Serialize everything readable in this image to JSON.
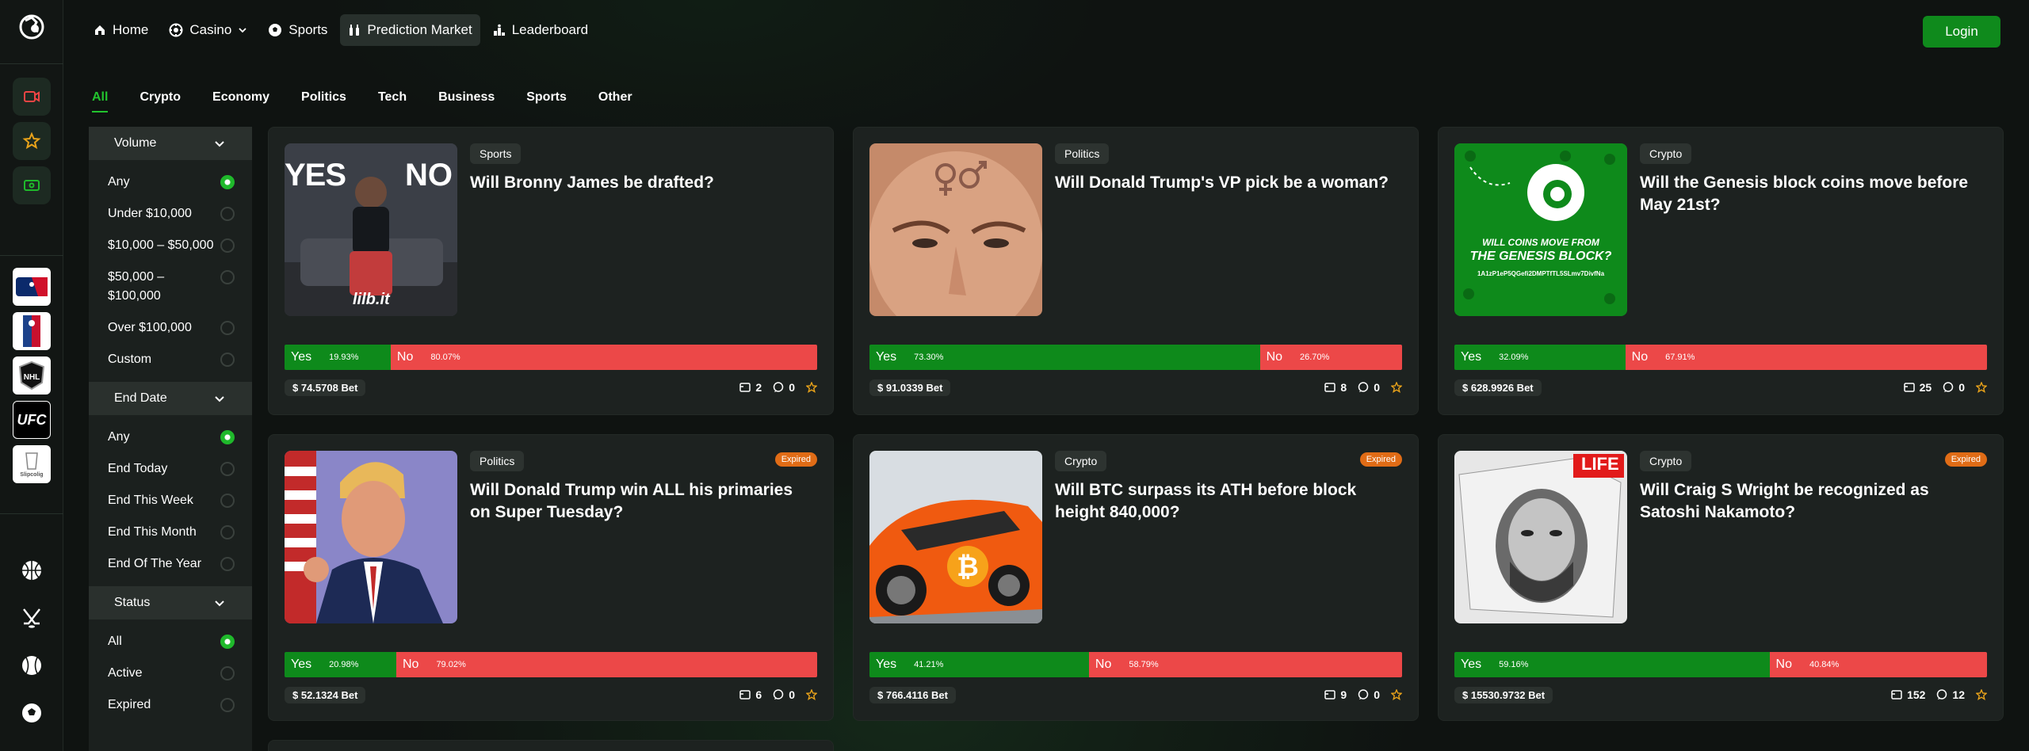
{
  "nav": {
    "home": "Home",
    "casino": "Casino",
    "sports": "Sports",
    "prediction": "Prediction Market",
    "leaderboard": "Leaderboard",
    "login": "Login"
  },
  "rail": {
    "leagues": [
      "MLB",
      "NBA",
      "NHL",
      "UFC",
      "Slipcolig"
    ],
    "sports": [
      "basketball-icon",
      "hockey-icon",
      "baseball-icon",
      "soccer-icon"
    ]
  },
  "categories": [
    "All",
    "Crypto",
    "Economy",
    "Politics",
    "Tech",
    "Business",
    "Sports",
    "Other"
  ],
  "filters": {
    "volume": {
      "title": "Volume",
      "options": [
        "Any",
        "Under $10,000",
        "$10,000 – $50,000",
        "$50,000 –\n$100,000",
        "Over $100,000",
        "Custom"
      ],
      "selected": 0
    },
    "end_date": {
      "title": "End Date",
      "options": [
        "Any",
        "End Today",
        "End This Week",
        "End This Month",
        "End Of The Year"
      ],
      "selected": 0
    },
    "status": {
      "title": "Status",
      "options": [
        "All",
        "Active",
        "Expired"
      ],
      "selected": 0
    }
  },
  "cards": [
    {
      "tag": "Sports",
      "title": "Will Bronny James be drafted?",
      "yes_label": "Yes",
      "no_label": "No",
      "yes_pct": "19.93%",
      "no_pct": "80.07%",
      "yes_value": 19.93,
      "bet": "$ 74.5708 Bet",
      "bets": "2",
      "comments": "0",
      "expired": "",
      "image": "yes-no-bronny"
    },
    {
      "tag": "Politics",
      "title": "Will Donald Trump's VP pick be a woman?",
      "yes_label": "Yes",
      "no_label": "No",
      "yes_pct": "73.30%",
      "no_pct": "26.70%",
      "yes_value": 73.3,
      "bet": "$ 91.0339 Bet",
      "bets": "8",
      "comments": "0",
      "expired": "",
      "image": "trump-face"
    },
    {
      "tag": "Crypto",
      "title": "Will the Genesis block coins move before May 21st?",
      "yes_label": "Yes",
      "no_label": "No",
      "yes_pct": "32.09%",
      "no_pct": "67.91%",
      "yes_value": 32.09,
      "bet": "$ 628.9926 Bet",
      "bets": "25",
      "comments": "0",
      "expired": "",
      "image": "genesis-block"
    },
    {
      "tag": "Politics",
      "title": "Will Donald Trump win ALL his primaries on Super Tuesday?",
      "yes_label": "Yes",
      "no_label": "No",
      "yes_pct": "20.98%",
      "no_pct": "79.02%",
      "yes_value": 20.98,
      "bet": "$ 52.1324 Bet",
      "bets": "6",
      "comments": "0",
      "expired": "Expired",
      "image": "trump-thumbs"
    },
    {
      "tag": "Crypto",
      "title": "Will BTC surpass its ATH before block height 840,000?",
      "yes_label": "Yes",
      "no_label": "No",
      "yes_pct": "41.21%",
      "no_pct": "58.79%",
      "yes_value": 41.21,
      "bet": "$ 766.4116 Bet",
      "bets": "9",
      "comments": "0",
      "expired": "Expired",
      "image": "btc-car"
    },
    {
      "tag": "Crypto",
      "title": "Will Craig S Wright be recognized as Satoshi Nakamoto?",
      "yes_label": "Yes",
      "no_label": "No",
      "yes_pct": "59.16%",
      "no_pct": "40.84%",
      "yes_value": 59.16,
      "bet": "$ 15530.9732 Bet",
      "bets": "152",
      "comments": "12",
      "expired": "Expired",
      "image": "life-magazine"
    }
  ],
  "images": {
    "bronny": {
      "yes": "YES",
      "no": "NO",
      "brand": "lilb.it"
    },
    "genesis": {
      "line1": "WILL COINS MOVE FROM",
      "line2": "THE GENESIS BLOCK?",
      "address": "1A1zP1eP5QGefi2DMPTfTL5SLmv7DivfNa"
    },
    "life": {
      "logo": "LIFE"
    }
  },
  "colors": {
    "accent": "#0f8a1c",
    "yes": "#0e8a1b",
    "no": "#ec4848",
    "expired": "#e06c16",
    "star": "#e8a21a"
  }
}
